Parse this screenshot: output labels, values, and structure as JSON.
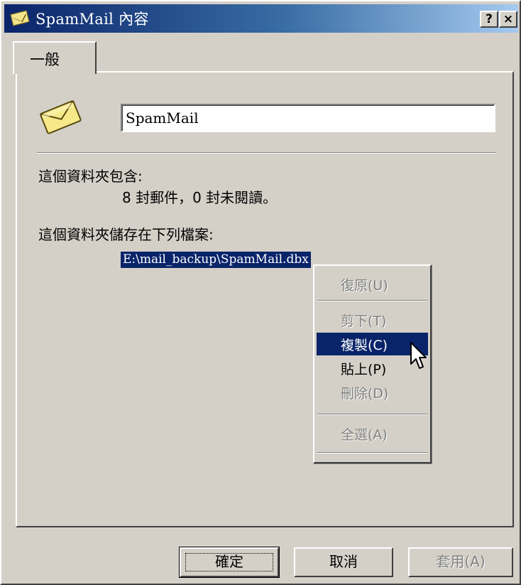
{
  "window": {
    "title": "SpamMail 內容",
    "help_label": "?",
    "close_label": "×"
  },
  "tabs": [
    {
      "label": "一般",
      "selected": true
    }
  ],
  "general": {
    "folder_name": "SpamMail",
    "contains_label": "這個資料夾包含:",
    "contains_value": "8 封郵件，0 封未閱讀。",
    "stored_label": "這個資料夾儲存在下列檔案:",
    "file_path": "E:\\mail_backup\\SpamMail.dbx"
  },
  "context_menu": {
    "items": [
      {
        "label": "復原(U)",
        "enabled": false
      },
      {
        "label": "剪下(T)",
        "enabled": false
      },
      {
        "label": "複製(C)",
        "enabled": true,
        "highlighted": true
      },
      {
        "label": "貼上(P)",
        "enabled": true
      },
      {
        "label": "刪除(D)",
        "enabled": false
      },
      {
        "label": "全選(A)",
        "enabled": false
      }
    ]
  },
  "buttons": {
    "ok": "確定",
    "cancel": "取消",
    "apply": "套用(A)"
  },
  "colors": {
    "title_start": "#0a246a",
    "title_end": "#a6caf0",
    "face": "#d4d0c8",
    "highlight": "#0a246a"
  }
}
